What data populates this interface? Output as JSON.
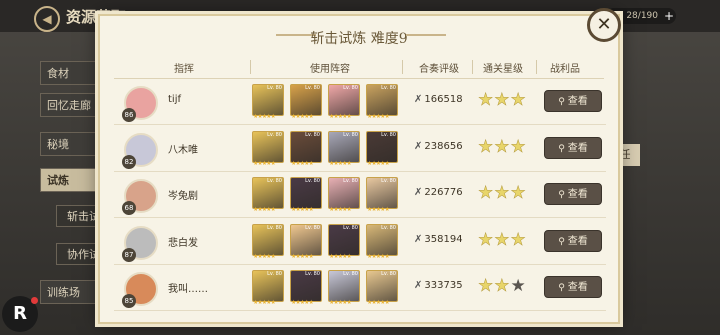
{
  "topbar": {
    "title": "资源获取",
    "resource": "28/190",
    "plus": "+"
  },
  "sidebar": {
    "items": [
      {
        "label": "食材"
      },
      {
        "label": "回忆走廊"
      },
      {
        "label": "秘境"
      },
      {
        "label": "试炼"
      },
      {
        "label": "训练场"
      }
    ],
    "subitems": [
      {
        "label": "斩击试"
      },
      {
        "label": "协作试"
      }
    ],
    "right_peek": "任"
  },
  "modal": {
    "title": "斩击试炼 难度9",
    "close_icon": "✕",
    "headers": {
      "commander": "指挥",
      "lineup": "使用阵容",
      "score": "合奏评级",
      "stars": "通关星级",
      "reward": "战利品"
    },
    "view_label": "查看",
    "rows": [
      {
        "level": "86",
        "name": "tijf",
        "score": "166518",
        "stars": [
          1,
          1,
          1
        ],
        "avatar_color": "#e9a3a0",
        "chars": [
          "#e8c35a",
          "#d8a24a",
          "#f0a8a8",
          "#caa35f"
        ]
      },
      {
        "level": "82",
        "name": "八木唯",
        "score": "238656",
        "stars": [
          1,
          1,
          1
        ],
        "avatar_color": "#c8c8d8",
        "chars": [
          "#e8c35a",
          "#6a4c3a",
          "#a8a8b8",
          "#4a3a36"
        ]
      },
      {
        "level": "68",
        "name": "岑兔剧",
        "score": "226776",
        "stars": [
          1,
          1,
          1
        ],
        "avatar_color": "#d8a38a",
        "chars": [
          "#e8c35a",
          "#4a3a46",
          "#e8b0b4",
          "#e8c8a0"
        ]
      },
      {
        "level": "87",
        "name": "悲白发",
        "score": "358194",
        "stars": [
          1,
          1,
          1
        ],
        "avatar_color": "#bcbcbc",
        "chars": [
          "#e8c35a",
          "#f0c890",
          "#4a3a46",
          "#d8b878"
        ]
      },
      {
        "level": "85",
        "name": "我叫……",
        "score": "333735",
        "stars": [
          1,
          1,
          0
        ],
        "avatar_color": "#d88a5a",
        "chars": [
          "#e8c35a",
          "#4a3a46",
          "#c8c8d8",
          "#e8c890"
        ]
      }
    ],
    "char_level": "Lv. 80"
  }
}
